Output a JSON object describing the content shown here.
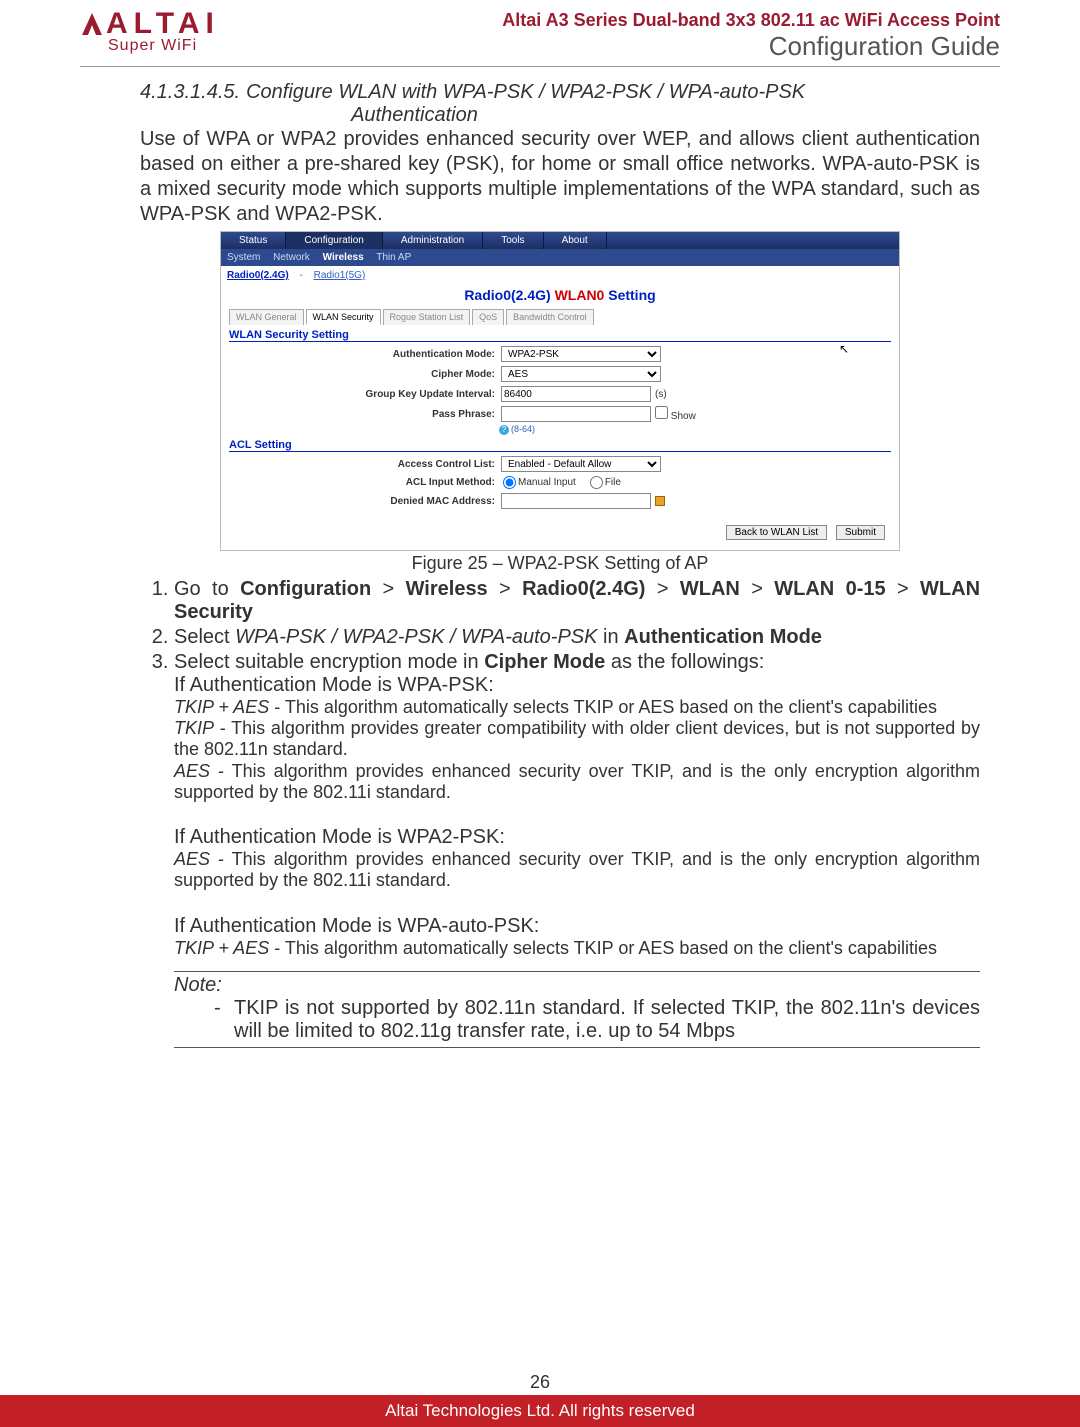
{
  "logo": {
    "main": "ALTAI",
    "sub": "Super WiFi"
  },
  "header": {
    "line1": "Altai A3 Series Dual-band 3x3 802.11 ac WiFi Access Point",
    "line2": "Configuration Guide"
  },
  "section": {
    "number": "4.1.3.1.4.5.",
    "title_line1": "Configure WLAN with WPA-PSK / WPA2-PSK / WPA-auto-PSK",
    "title_line2": "Authentication"
  },
  "intro": "Use of WPA or WPA2 provides enhanced security over WEP, and allows client authentication based on either a pre-shared key (PSK), for home or small office networks. WPA-auto-PSK is a mixed security mode which supports multiple implementations of the WPA standard, such as WPA-PSK and WPA2-PSK.",
  "shot": {
    "topnav": [
      "Status",
      "Configuration",
      "Administration",
      "Tools",
      "About"
    ],
    "topnav_active": 1,
    "subnav": [
      "System",
      "Network",
      "Wireless",
      "Thin AP"
    ],
    "subnav_active": 2,
    "radio0": "Radio0(2.4G)",
    "radio1": "Radio1(5G)",
    "panel_title_b": "Radio0(2.4G) ",
    "panel_title_r": "WLAN0",
    "panel_title_b2": " Setting",
    "tabs2": [
      "WLAN General",
      "WLAN Security",
      "Rogue Station List",
      "QoS",
      "Bandwidth Control"
    ],
    "tabs2_active": 1,
    "sec1": "WLAN Security Setting",
    "fields": {
      "auth_label": "Authentication Mode:",
      "auth_value": "WPA2-PSK",
      "cipher_label": "Cipher Mode:",
      "cipher_value": "AES",
      "gku_label": "Group Key Update Interval:",
      "gku_value": "86400",
      "gku_suffix": "(s)",
      "pass_label": "Pass Phrase:",
      "pass_value": "",
      "show_label": "Show",
      "pass_hint": "(8-64)"
    },
    "sec2": "ACL Setting",
    "acl": {
      "list_label": "Access Control List:",
      "list_value": "Enabled - Default Allow",
      "input_label": "ACL Input Method:",
      "input_opt1": "Manual Input",
      "input_opt2": "File",
      "denied_label": "Denied MAC Address:"
    },
    "buttons": {
      "back": "Back to WLAN List",
      "submit": "Submit"
    }
  },
  "caption": "Figure 25 – WPA2-PSK Setting of AP",
  "steps": {
    "s1_pre": "Go to ",
    "s1_path": [
      "Configuration",
      "Wireless",
      "Radio0(2.4G)",
      "WLAN",
      "WLAN 0-15",
      "WLAN Security"
    ],
    "s2_pre": "Select ",
    "s2_em": "WPA-PSK / WPA2-PSK / WPA-auto-PSK",
    "s2_mid": " in ",
    "s2_b": "Authentication Mode",
    "s3_pre": "Select suitable encryption mode in ",
    "s3_b": "Cipher Mode",
    "s3_post": " as the followings:",
    "wpa_psk_head": "If Authentication Mode is WPA-PSK:",
    "tkip_aes_label": "TKIP + AES",
    "tkip_aes_desc": " - This algorithm automatically selects TKIP or AES based on the client's capabilities",
    "tkip_label": "TKIP",
    "tkip_desc": " - This algorithm provides greater compatibility with older client devices, but is not supported by the 802.11n standard.",
    "aes_label": "AES",
    "aes_desc": " - This algorithm provides enhanced security over TKIP, and is the only encryption algorithm supported by the 802.11i standard.",
    "wpa2_psk_head": "If Authentication Mode is WPA2-PSK:",
    "wpa_auto_head": "If Authentication Mode is WPA-auto-PSK:"
  },
  "note": {
    "label": "Note:",
    "item": "TKIP is not supported by 802.11n standard. If selected TKIP, the 802.11n's devices will be limited to 802.11g transfer rate, i.e. up to 54 Mbps"
  },
  "footer": {
    "page": "26",
    "copyright": "Altai Technologies Ltd. All rights reserved"
  }
}
